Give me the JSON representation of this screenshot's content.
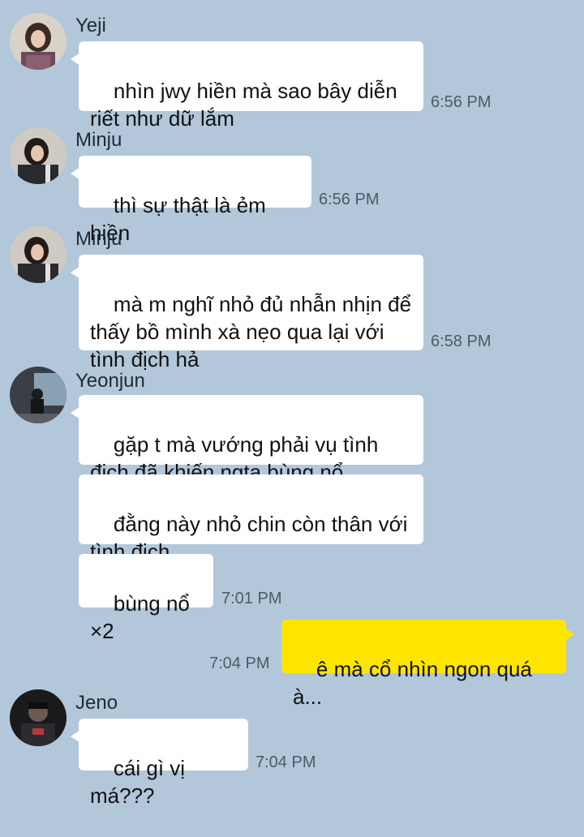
{
  "colors": {
    "background": "#b2c7da",
    "incoming_bubble": "#ffffff",
    "outgoing_bubble": "#fee500"
  },
  "messages": [
    {
      "sender": "Yeji",
      "avatar": "profile-photo",
      "lines": [
        "nhìn jwy hiền mà sao bây diễn",
        "riết như dữ lắm"
      ],
      "time": "6:56 PM"
    },
    {
      "sender": "Minju",
      "avatar": "profile-photo",
      "lines": [
        "thì sự thật là ẻm hiền"
      ],
      "time": "6:56 PM"
    },
    {
      "sender": "Minju",
      "avatar": "profile-photo",
      "lines": [
        "mà m nghĩ nhỏ đủ nhẫn nhịn để",
        "thấy bồ mình xà nẹo qua lại với",
        "tình địch hả"
      ],
      "time": "6:58 PM"
    },
    {
      "sender": "Yeonjun",
      "avatar": "profile-photo",
      "bubbles": [
        {
          "lines": [
            "gặp t mà vướng phải vụ tình",
            "địch đã khiến ngta bùng nổ"
          ]
        },
        {
          "lines": [
            "đằng này nhỏ chin còn thân với",
            "tình địch"
          ]
        },
        {
          "lines": [
            "bùng nổ ×2"
          ]
        }
      ],
      "time": "7:01 PM"
    },
    {
      "sender": "me",
      "lines": [
        "ê mà cổ nhìn ngon quá à..."
      ],
      "time": "7:04 PM"
    },
    {
      "sender": "Jeno",
      "avatar": "profile-photo",
      "lines": [
        "cái gì vị má???"
      ],
      "time": "7:04 PM"
    }
  ]
}
